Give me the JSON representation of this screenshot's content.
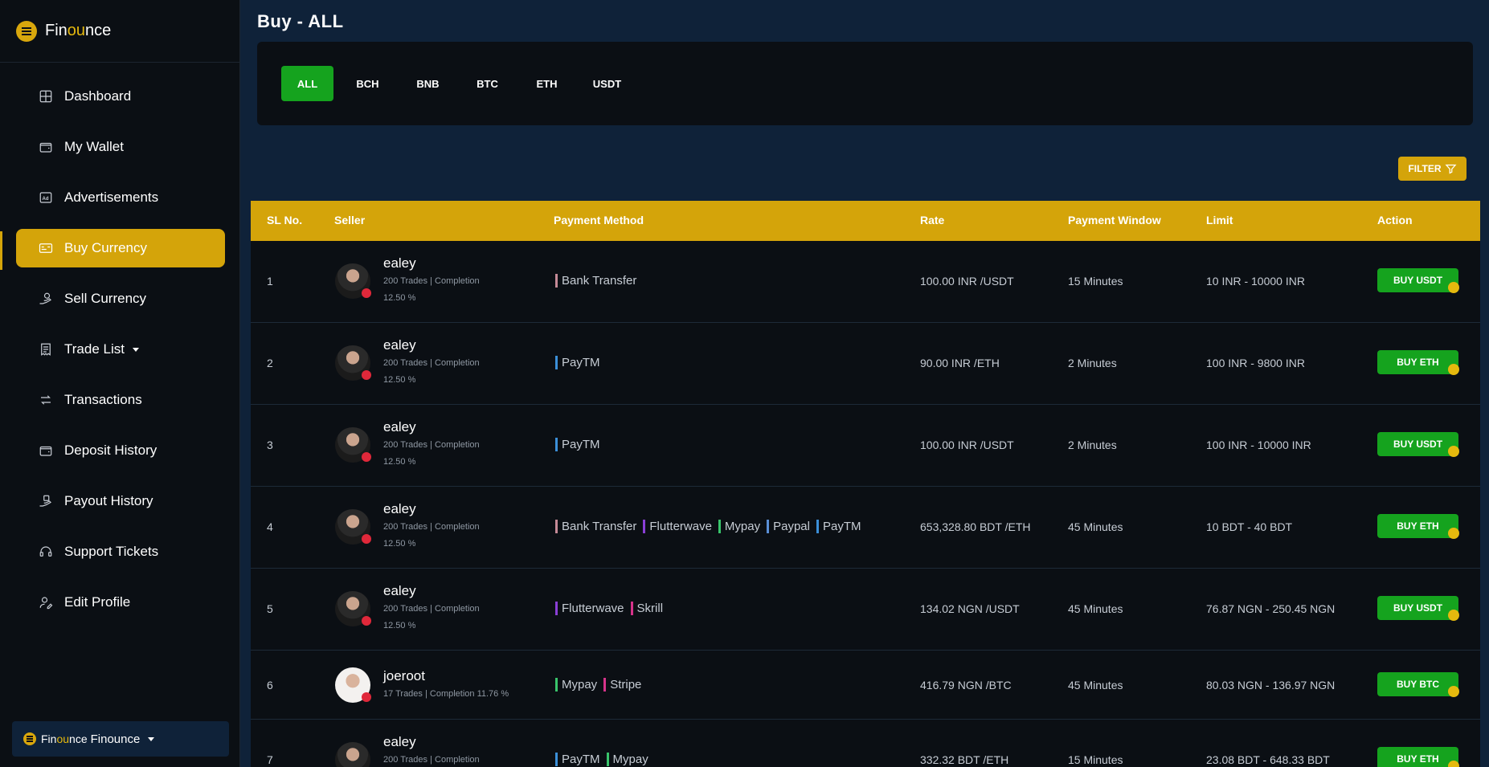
{
  "brand": {
    "prefix": "Fin",
    "mid": "ou",
    "suffix": "nce"
  },
  "nav": [
    {
      "label": "Dashboard",
      "icon": "grid-icon"
    },
    {
      "label": "My Wallet",
      "icon": "wallet-icon"
    },
    {
      "label": "Advertisements",
      "icon": "ad-icon"
    },
    {
      "label": "Buy Currency",
      "icon": "card-icon"
    },
    {
      "label": "Sell Currency",
      "icon": "hand-coin-icon"
    },
    {
      "label": "Trade List",
      "icon": "receipt-icon"
    },
    {
      "label": "Transactions",
      "icon": "swap-icon"
    },
    {
      "label": "Deposit History",
      "icon": "wallet-icon"
    },
    {
      "label": "Payout History",
      "icon": "hand-cash-icon"
    },
    {
      "label": "Support Tickets",
      "icon": "headset-icon"
    },
    {
      "label": "Edit Profile",
      "icon": "user-edit-icon"
    }
  ],
  "account": {
    "label": "Finounce"
  },
  "page": {
    "title": "Buy - ALL"
  },
  "tabs": [
    "ALL",
    "BCH",
    "BNB",
    "BTC",
    "ETH",
    "USDT"
  ],
  "filter": {
    "label": "FILTER"
  },
  "table": {
    "headers": {
      "sl": "SL No.",
      "seller": "Seller",
      "payment": "Payment Method",
      "rate": "Rate",
      "window": "Payment Window",
      "limit": "Limit",
      "action": "Action"
    },
    "rows": [
      {
        "sl": "1",
        "name": "ealey",
        "meta": "200 Trades | Completion 12.50 %",
        "methods": [
          "Bank Transfer"
        ],
        "rate": "100.00 INR /USDT",
        "window": "15 Minutes",
        "limit": "10 INR - 10000 INR",
        "action": "BUY USDT"
      },
      {
        "sl": "2",
        "name": "ealey",
        "meta": "200 Trades | Completion 12.50 %",
        "methods": [
          "PayTM"
        ],
        "rate": "90.00 INR /ETH",
        "window": "2 Minutes",
        "limit": "100 INR - 9800 INR",
        "action": "BUY ETH"
      },
      {
        "sl": "3",
        "name": "ealey",
        "meta": "200 Trades | Completion 12.50 %",
        "methods": [
          "PayTM"
        ],
        "rate": "100.00 INR /USDT",
        "window": "2 Minutes",
        "limit": "100 INR - 10000 INR",
        "action": "BUY USDT"
      },
      {
        "sl": "4",
        "name": "ealey",
        "meta": "200 Trades | Completion 12.50 %",
        "methods": [
          "Bank Transfer",
          "Flutterwave",
          "Mypay",
          "Paypal",
          "PayTM"
        ],
        "rate": "653,328.80 BDT /ETH",
        "window": "45 Minutes",
        "limit": "10 BDT - 40 BDT",
        "action": "BUY ETH"
      },
      {
        "sl": "5",
        "name": "ealey",
        "meta": "200 Trades | Completion 12.50 %",
        "methods": [
          "Flutterwave",
          "Skrill"
        ],
        "rate": "134.02 NGN /USDT",
        "window": "45 Minutes",
        "limit": "76.87 NGN - 250.45 NGN",
        "action": "BUY USDT"
      },
      {
        "sl": "6",
        "name": "joeroot",
        "meta": "17 Trades | Completion 11.76 %",
        "methods": [
          "Mypay",
          "Stripe"
        ],
        "rate": "416.79 NGN /BTC",
        "window": "45 Minutes",
        "limit": "80.03 NGN - 136.97 NGN",
        "action": "BUY BTC"
      },
      {
        "sl": "7",
        "name": "ealey",
        "meta": "200 Trades | Completion",
        "methods": [
          "PayTM",
          "Mypay"
        ],
        "rate": "332.32 BDT /ETH",
        "window": "15 Minutes",
        "limit": "23.08 BDT - 648.33 BDT",
        "action": "BUY ETH"
      }
    ]
  },
  "method_colors": {
    "Bank Transfer": "#c58a97",
    "PayTM": "#3b8fd8",
    "Flutterwave": "#8a3fd6",
    "Mypay": "#39c46b",
    "Paypal": "#5a8fd6",
    "Skrill": "#d6338a",
    "Stripe": "#d6338a"
  },
  "colors": {
    "accent": "#d4a40a",
    "success": "#15a31e",
    "bg": "#0f2239",
    "panel": "#0b0f14"
  }
}
